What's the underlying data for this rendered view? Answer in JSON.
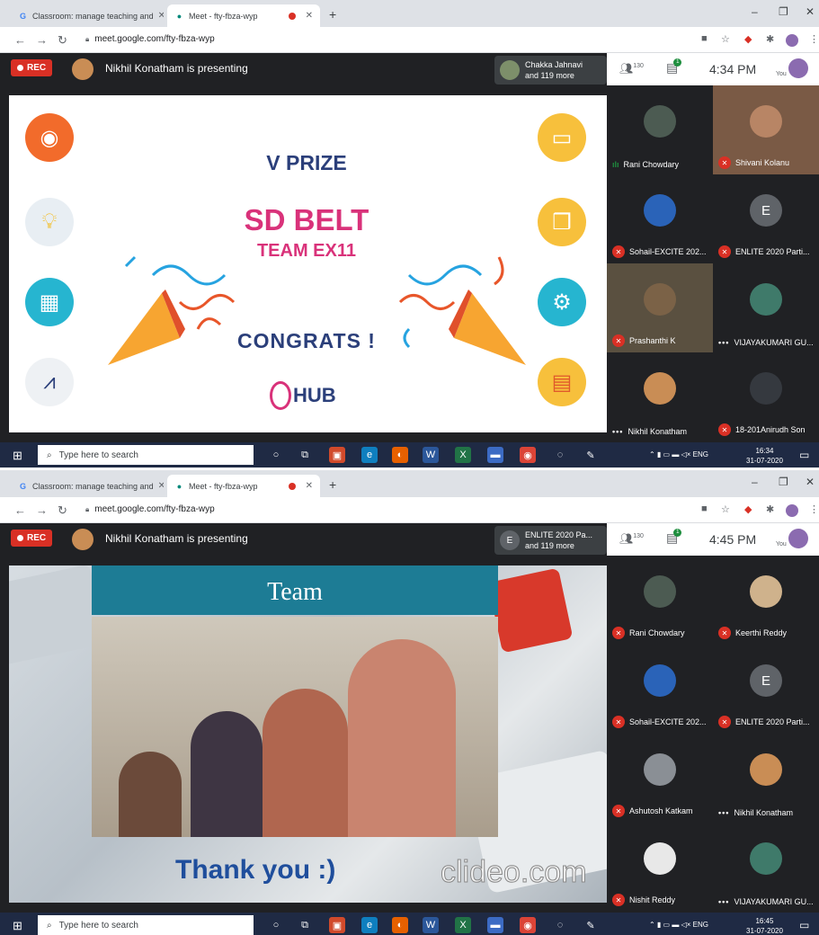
{
  "screens": [
    {
      "tabs": {
        "classroom": "Classroom: manage teaching and",
        "meet": "Meet - fty-fbza-wyp"
      },
      "url": "meet.google.com/fty-fbza-wyp",
      "rec": "REC",
      "presenting": "Nikhil Konatham is presenting",
      "speaker": {
        "initial": "",
        "name": "Chakka Jahnavi",
        "more": "and 119 more"
      },
      "people_count": "130",
      "chat_badge": "1",
      "time": "4:34 PM",
      "you": "You",
      "slide": {
        "prize": "V PRIZE",
        "belt": "SD BELT",
        "team": "TEAM EX11",
        "congrats": "CONGRATS !",
        "logo": "HUB"
      },
      "participants": [
        "Rani Chowdary",
        "Shivani Kolanu",
        "Sohail-EXCITE 202...",
        "ENLITE 2020 Parti...",
        "Prashanthi K",
        "VIJAYAKUMARI GU...",
        "Nikhil Konatham",
        "18-201Anirudh Son"
      ],
      "tile_initial": "E",
      "taskbar": {
        "search": "Type here to search",
        "lang": "ENG",
        "time": "16:34",
        "date": "31-07-2020"
      }
    },
    {
      "tabs": {
        "classroom": "Classroom: manage teaching and",
        "meet": "Meet - fty-fbza-wyp"
      },
      "url": "meet.google.com/fty-fbza-wyp",
      "rec": "REC",
      "presenting": "Nikhil Konatham is presenting",
      "speaker": {
        "initial": "E",
        "name": "ENLITE 2020 Pa...",
        "more": "and 119 more"
      },
      "people_count": "130",
      "chat_badge": "1",
      "time": "4:45 PM",
      "you": "You",
      "slide": {
        "team": "Team",
        "thanks": "Thank you :)",
        "watermark": "clideo.com"
      },
      "participants": [
        "Rani Chowdary",
        "Keerthi Reddy",
        "Sohail-EXCITE 202...",
        "ENLITE 2020 Parti...",
        "Ashutosh Katkam",
        "Nikhil Konatham",
        "Nishit Reddy",
        "VIJAYAKUMARI GU..."
      ],
      "tile_initial": "E",
      "taskbar": {
        "search": "Type here to search",
        "lang": "ENG",
        "time": "16:45",
        "date": "31-07-2020"
      }
    }
  ],
  "colors": {
    "rec": "#d93025",
    "meet_bg": "#202124",
    "slide_navy": "#2b3f7a",
    "slide_pink": "#d9327a",
    "taskbar": "#1f2a44"
  }
}
